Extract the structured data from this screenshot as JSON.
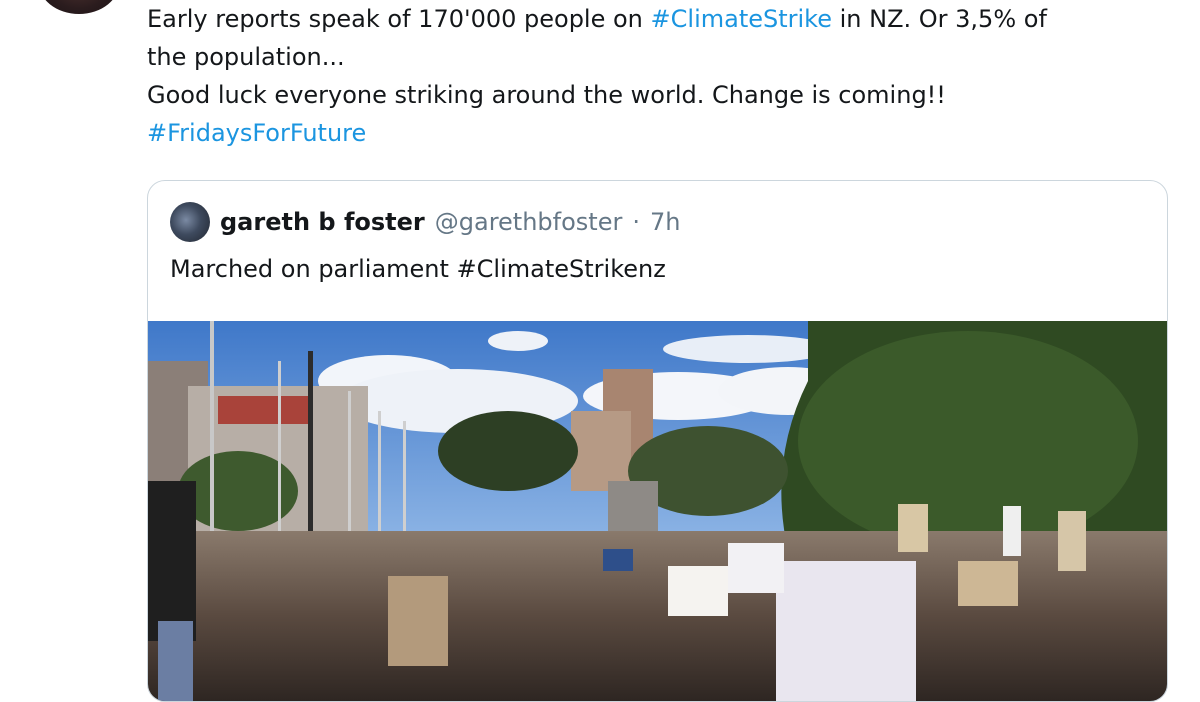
{
  "tweet": {
    "lines": [
      [
        {
          "text": "Early reports speak of 170'000 people on "
        },
        {
          "text": "#ClimateStrike",
          "hashtag": true
        },
        {
          "text": " in NZ. Or 3,5% of"
        }
      ],
      [
        {
          "text": "the population..."
        }
      ],
      [
        {
          "text": "Good luck everyone striking around the world. Change is coming!!"
        }
      ],
      [
        {
          "text": "#FridaysForFuture",
          "hashtag": true
        }
      ]
    ]
  },
  "quote": {
    "name": "gareth b foster",
    "handle": "@garethbfoster",
    "separator": "·",
    "time": "7h",
    "text": "Marched on parliament #ClimateStrikenz"
  },
  "media": {
    "description_icon": "crowd-photo"
  },
  "colors": {
    "text": "#14171a",
    "hashtag": "#1b95e0",
    "secondary": "#657786",
    "border": "#ccd6dd"
  }
}
